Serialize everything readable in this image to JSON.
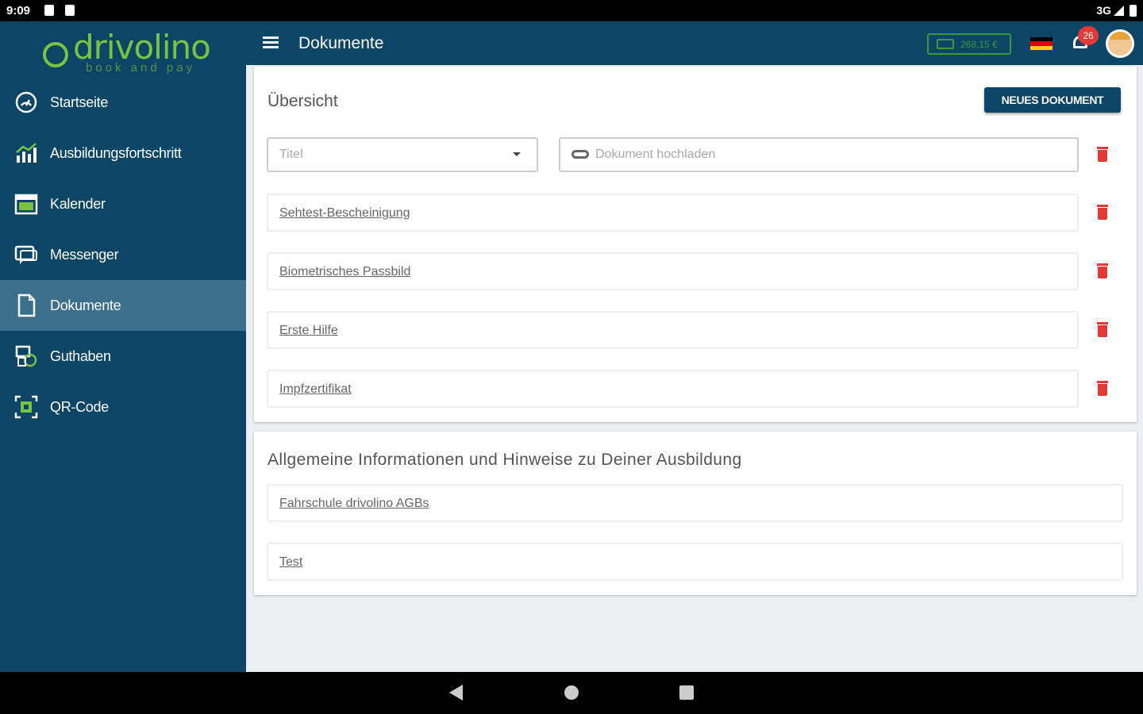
{
  "status": {
    "time": "9:09",
    "network": "3G"
  },
  "brand": {
    "name": "drivolino",
    "tagline": "book and pay"
  },
  "sidebar": {
    "items": [
      {
        "label": "Startseite",
        "icon": "speedometer-icon"
      },
      {
        "label": "Ausbildungsfortschritt",
        "icon": "chart-icon"
      },
      {
        "label": "Kalender",
        "icon": "calendar-icon"
      },
      {
        "label": "Messenger",
        "icon": "chat-icon"
      },
      {
        "label": "Dokumente",
        "icon": "document-icon",
        "active": true
      },
      {
        "label": "Guthaben",
        "icon": "coins-icon"
      },
      {
        "label": "QR-Code",
        "icon": "qr-icon"
      }
    ]
  },
  "header": {
    "title": "Dokumente",
    "credit": "268,15 €",
    "notifications": "26"
  },
  "overview": {
    "title": "Übersicht",
    "new_button": "NEUES DOKUMENT",
    "select_placeholder": "Titel",
    "upload_placeholder": "Dokument hochladen",
    "documents": [
      "Sehtest-Bescheinigung",
      "Biometrisches Passbild",
      "Erste Hilfe",
      "Impfzertifikat"
    ]
  },
  "info": {
    "title": "Allgemeine Informationen und Hinweise zu Deiner Ausbildung",
    "documents": [
      "Fahrschule drivolino AGBs",
      "Test"
    ]
  },
  "colors": {
    "sidebar": "#0d4566",
    "active": "#3c6f8c",
    "brand_green": "#7cc242",
    "delete_red": "#e53935"
  }
}
